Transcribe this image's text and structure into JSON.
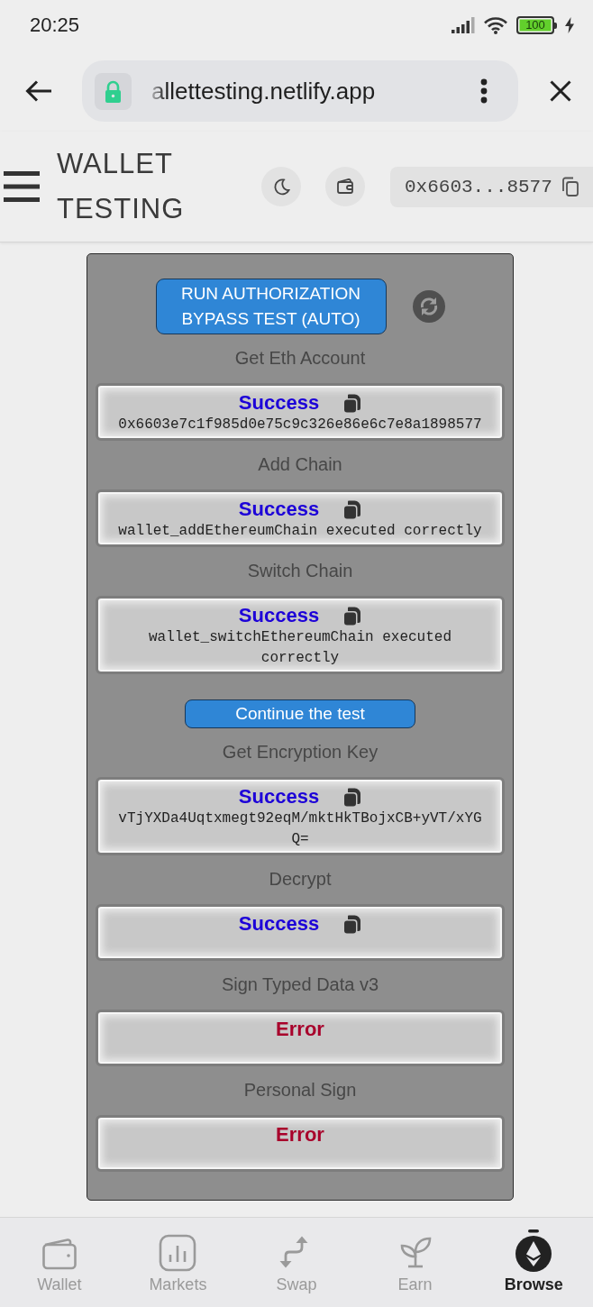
{
  "status_bar": {
    "time": "20:25",
    "battery": "100"
  },
  "browser": {
    "url": "allettesting.netlify.app"
  },
  "header": {
    "title": "WALLET TESTING",
    "account": "0x6603...8577"
  },
  "panel": {
    "run_button": "RUN AUTHORIZATION BYPASS TEST (AUTO)",
    "items": [
      {
        "kind": "test",
        "title": "Get Eth Account",
        "color": "#1c00d8",
        "status": "Success",
        "copy": true,
        "detail": "0x6603e7c1f985d0e75c9c326e86e6c7e8a1898577"
      },
      {
        "kind": "test",
        "title": "Add Chain",
        "color": "#1c00d8",
        "status": "Success",
        "copy": true,
        "detail": "wallet_addEthereumChain executed correctly"
      },
      {
        "kind": "test",
        "title": "Switch Chain",
        "color": "#1c00d8",
        "status": "Success",
        "copy": true,
        "detail": "wallet_switchEthereumChain executed correctly"
      },
      {
        "kind": "button",
        "label": "Continue the test"
      },
      {
        "kind": "test",
        "title": "Get Encryption Key",
        "color": "#1c00d8",
        "status": "Success",
        "copy": true,
        "detail": "vTjYXDa4Uqtxmegt92eqM/mktHkTBojxCB+yVT/xYGQ="
      },
      {
        "kind": "test",
        "title": "Decrypt",
        "color": "#1c00d8",
        "status": "Success",
        "copy": true
      },
      {
        "kind": "test",
        "title": "Sign Typed Data v3",
        "color": "#a8002b",
        "status": "Error",
        "copy": false
      },
      {
        "kind": "test",
        "title": "Personal Sign",
        "color": "#a8002b",
        "status": "Error",
        "copy": false
      }
    ]
  },
  "bottom_nav": [
    {
      "label": "Wallet",
      "selected": false
    },
    {
      "label": "Markets",
      "selected": false
    },
    {
      "label": "Swap",
      "selected": false
    },
    {
      "label": "Earn",
      "selected": false
    },
    {
      "label": "Browse",
      "selected": true
    }
  ]
}
